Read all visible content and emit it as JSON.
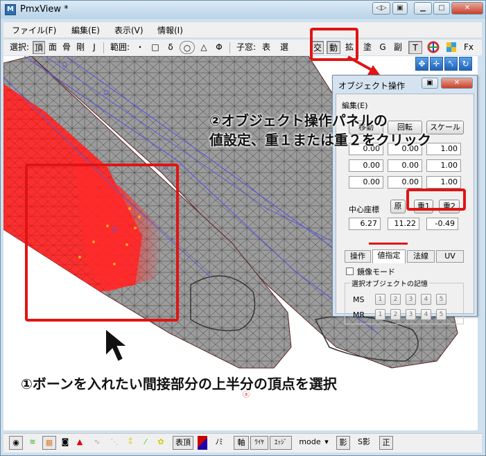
{
  "window": {
    "title": "PmxView *",
    "app_icon": "pmxview-app-icon"
  },
  "menu": [
    "ファイル(F)",
    "編集(E)",
    "表示(V)",
    "情報(I)"
  ],
  "toolbar": {
    "select_label": "選択:",
    "select_items": [
      "頂",
      "面",
      "骨",
      "剛",
      "J"
    ],
    "range_label": "範囲:",
    "range_items": [
      "・",
      "□",
      "δ",
      "○",
      "△",
      "Φ"
    ],
    "child_label": "子窓:",
    "child_items": [
      "表",
      "選",
      "交",
      "動",
      "拡",
      "塗",
      "G",
      "副",
      "T"
    ],
    "fx_label": "Fx"
  },
  "view_tools": [
    "move-xyz-icon",
    "move-icon",
    "rotate-icon",
    "refresh-icon"
  ],
  "panel": {
    "title": "オブジェクト操作",
    "menu": "編集(E)",
    "top_buttons": [
      "移動",
      "回転",
      "スケール"
    ],
    "row1": [
      "0.00",
      "0.00",
      "1.00"
    ],
    "row2": [
      "0.00",
      "0.00",
      "1.00"
    ],
    "row3": [
      "0.00",
      "0.00",
      "1.00"
    ],
    "center_label": "中心座標",
    "center_buttons": [
      "原",
      "重1",
      "重2"
    ],
    "center_values": [
      "6.27",
      "11.22",
      "-0.49"
    ],
    "tabs": [
      "操作",
      "値指定",
      "法線",
      "UV"
    ],
    "mirror_mode": "鏡像モード",
    "memory_title": "選択オブジェクトの記憶",
    "ms_label": "MS",
    "mr_label": "MR",
    "memory_slots": [
      "1",
      "2",
      "3",
      "4",
      "5"
    ]
  },
  "bottombar": {
    "items": [
      "表頂",
      "ﾉﾐ",
      "軸",
      "ﾜｲﾔ",
      "ｴｯｼﾞ",
      "mode",
      "影",
      "S影",
      "正"
    ],
    "mode_arrow": "▾"
  },
  "annotations": {
    "step2_line1": "②オブジェクト操作パネルの",
    "step2_line2": "値設定、重１または重２をクリック",
    "step1": "①ボーンを入れたい間接部分の上半分の頂点を選択"
  },
  "colors": {
    "annotation": "#e01414",
    "selection": "#ff2020",
    "wire": "#5a5ad8",
    "mesh": "#9c9c9c"
  }
}
